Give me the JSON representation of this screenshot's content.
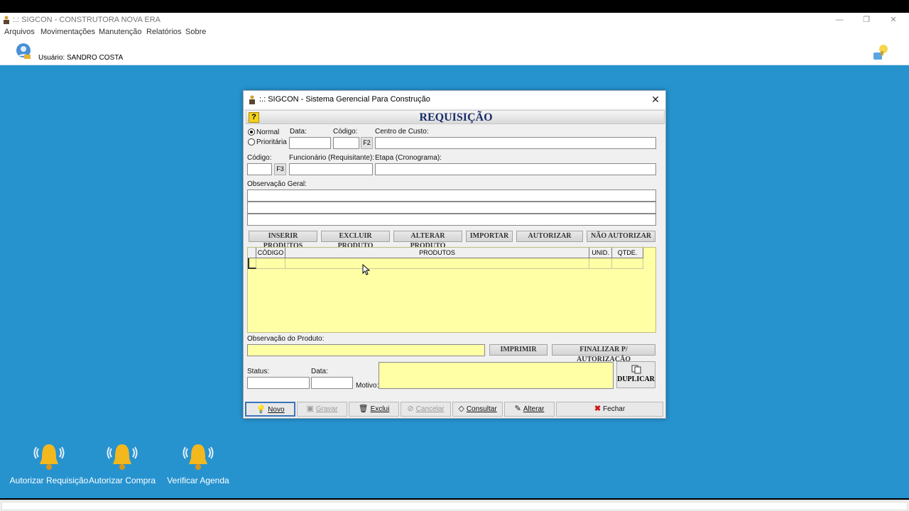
{
  "app": {
    "title": ":.: SIGCON - CONSTRUTORA NOVA ERA",
    "menu": [
      "Arquivos",
      "Movimentações",
      "Manutenção",
      "Relatórios",
      "Sobre"
    ],
    "user_label": "Usuário: SANDRO COSTA"
  },
  "window_controls": {
    "minimize": "—",
    "restore": "❐",
    "close": "✕"
  },
  "dialog": {
    "title": ":.: SIGCON - Sistema Gerencial Para Construção",
    "close": "✕",
    "header": "REQUISIÇÃO",
    "help": "?",
    "priority": {
      "normal": "Normal",
      "prioritaria": "Prioritária",
      "selected": "Normal"
    },
    "labels": {
      "data": "Data:",
      "codigo": "Código:",
      "centro_custo": "Centro de Custo:",
      "codigo2": "Código:",
      "funcionario": "Funcionário (Requisitante):",
      "etapa": "Etapa (Cronograma):",
      "observacao_geral": "Observação Geral:",
      "observacao_produto": "Observação do Produto:",
      "status": "Status:",
      "data2": "Data:",
      "motivo": "Motivo:"
    },
    "f2": "F2",
    "f3": "F3",
    "actions": [
      "INSERIR PRODUTOS",
      "EXCLUIR PRODUTO",
      "ALTERAR PRODUTO",
      "IMPORTAR",
      "AUTORIZAR",
      "NÃO AUTORIZAR"
    ],
    "grid": {
      "columns": [
        "CÓDIGO",
        "PRODUTOS",
        "UNID.",
        "QTDE."
      ]
    },
    "imprimir": "IMPRIMIR",
    "finalizar": "FINALIZAR P/ AUTORIZAÇÃO",
    "duplicar": "DUPLICAR",
    "bottom": {
      "novo": "Novo",
      "gravar": "Gravar",
      "exclui": "Exclui",
      "cancelar": "Cancelar",
      "consultar": "Consultar",
      "alterar": "Alterar",
      "fechar": "Fechar"
    }
  },
  "shortcuts": [
    "Autorizar Requisição",
    "Autorizar Compra",
    "Verificar Agenda"
  ],
  "colors": {
    "desktop": "#2693cf",
    "grid": "#ffffa6",
    "header_title": "#1a2d6b"
  }
}
